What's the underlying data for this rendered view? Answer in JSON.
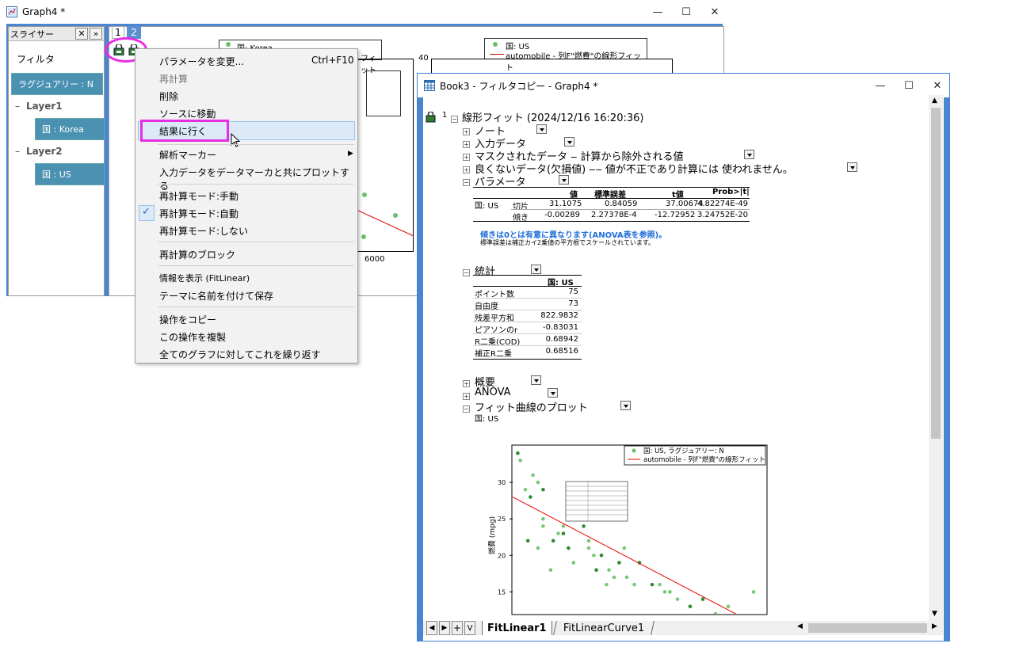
{
  "graph4": {
    "title": "Graph4 *",
    "slicer": {
      "header": "スライサー",
      "filter_label": "フィルタ",
      "ragular_btn": "ラグジュアリー : N",
      "layer1": "Layer1",
      "layer1_btn": "国 : Korea",
      "layer2": "Layer2",
      "layer2_btn": "国 : US"
    },
    "tabs": [
      "1",
      "2"
    ],
    "legend_left": "国: Korea",
    "legend_left_extra": "フィット",
    "legend_right_1": "国: US",
    "legend_right_2": "automobile - 列F\"燃費\"の線形フィット",
    "axis_40": "40",
    "axis_6000": "6000"
  },
  "menu": {
    "items": [
      {
        "label": "パラメータを変更...",
        "shortcut": "Ctrl+F10"
      },
      {
        "label": "再計算"
      },
      {
        "label": "削除"
      },
      {
        "label": "ソースに移動"
      },
      {
        "label": "結果に行く"
      },
      {
        "label": "解析マーカー"
      },
      {
        "label": "入力データをデータマーカと共にプロットする"
      },
      {
        "label": "再計算モード:手動"
      },
      {
        "label": "再計算モード:自動"
      },
      {
        "label": "再計算モード:しない"
      },
      {
        "label": "再計算のブロック"
      },
      {
        "label": "情報を表示 (FitLinear)"
      },
      {
        "label": "テーマに名前を付けて保存"
      },
      {
        "label": "操作をコピー"
      },
      {
        "label": "この操作を複製"
      },
      {
        "label": "全てのグラフに対してこれを繰り返す"
      }
    ]
  },
  "book3": {
    "title": "Book3 - フィルタコピー - Graph4 *",
    "report": {
      "index": "1",
      "heading": "線形フィット (2024/12/16 16:20:36)",
      "sections": [
        "ノート",
        "入力データ",
        "マスクされたデータ ‒ 計算から除外される値",
        "良くないデータ(欠損値) ‒‒ 値が不正であり計算には 使われません。",
        "パラメータ"
      ],
      "param_headers": [
        "値",
        "標準誤差",
        "t値",
        "Prob>|t|"
      ],
      "param_group": "国: US",
      "param_rows": [
        [
          "切片",
          "31.1075",
          "0.84059",
          "37.00674",
          "4.82274E-49"
        ],
        [
          "傾き",
          "-0.00289",
          "2.27378E-4",
          "-12.72952",
          "3.24752E-20"
        ]
      ],
      "note_blue": "傾きは0とは有意に異なります(ANOVA表を参照)。",
      "note_black": "標準誤差は補正カイ2乗値の平方根でスケールされています。",
      "stats_title": "統計",
      "stats_col": "国: US",
      "stats_rows": [
        [
          "ポイント数",
          "75"
        ],
        [
          "自由度",
          "73"
        ],
        [
          "残差平方和",
          "822.9832"
        ],
        [
          "ピアソンのr",
          "-0.83031"
        ],
        [
          "R二乗(COD)",
          "0.68942"
        ],
        [
          "補正R二乗",
          "0.68516"
        ]
      ],
      "sec_summary": "概要",
      "sec_anova": "ANOVA",
      "sec_fitplot": "フィット曲線のプロット",
      "fitplot_sub": "国: US",
      "plot_legend_1": "国: US, ラグジュアリー: N",
      "plot_legend_2": "automobile - 列F\"燃費\"の線形フィット",
      "plot_ylabel": "燃費 (mpg)"
    },
    "sheet_tabs": [
      "FitLinear1",
      "FitLinearCurve1"
    ]
  },
  "chart_data": {
    "type": "scatter",
    "xlabel": "",
    "ylabel": "燃費 (mpg)",
    "y_ticks": [
      "30",
      "25",
      "20",
      "15"
    ],
    "ylim": [
      12,
      35
    ],
    "series": [
      {
        "name": "国: US, ラグジュアリー: N",
        "points": [
          [
            0.02,
            34
          ],
          [
            0.03,
            33
          ],
          [
            0.05,
            29
          ],
          [
            0.07,
            28
          ],
          [
            0.08,
            31
          ],
          [
            0.1,
            30
          ],
          [
            0.12,
            29
          ],
          [
            0.12,
            25
          ],
          [
            0.12,
            24
          ],
          [
            0.16,
            22
          ],
          [
            0.18,
            23
          ],
          [
            0.2,
            24
          ],
          [
            0.22,
            21
          ],
          [
            0.24,
            19
          ],
          [
            0.26,
            25
          ],
          [
            0.28,
            24
          ],
          [
            0.3,
            22
          ],
          [
            0.32,
            20
          ],
          [
            0.35,
            20
          ],
          [
            0.38,
            18
          ],
          [
            0.4,
            17
          ],
          [
            0.42,
            19
          ],
          [
            0.45,
            17
          ],
          [
            0.48,
            16
          ],
          [
            0.55,
            16
          ],
          [
            0.6,
            15
          ],
          [
            0.65,
            14
          ],
          [
            0.7,
            13
          ],
          [
            0.8,
            12
          ],
          [
            0.95,
            15
          ],
          [
            0.06,
            22
          ],
          [
            0.1,
            21
          ],
          [
            0.15,
            18
          ],
          [
            0.2,
            23
          ],
          [
            0.25,
            26
          ],
          [
            0.3,
            21
          ],
          [
            0.33,
            18
          ],
          [
            0.37,
            16
          ],
          [
            0.44,
            21
          ],
          [
            0.5,
            19
          ],
          [
            0.58,
            16
          ],
          [
            0.62,
            15
          ],
          [
            0.75,
            14
          ],
          [
            0.85,
            13
          ]
        ]
      },
      {
        "name": "automobile - 列F\"燃費\"の線形フィット",
        "line": [
          [
            0,
            28
          ],
          [
            1,
            9.8
          ]
        ]
      }
    ]
  }
}
